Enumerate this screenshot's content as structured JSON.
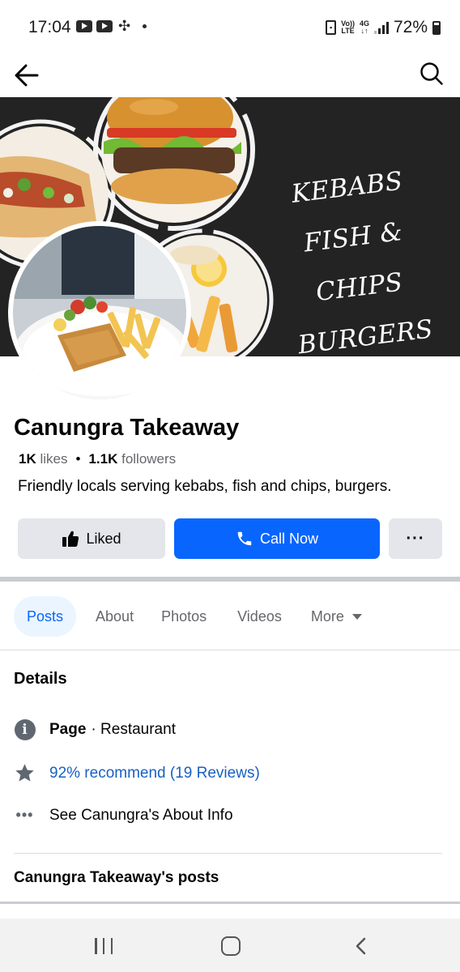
{
  "status_bar": {
    "time": "17:04",
    "battery": "72%",
    "volte_line1": "Vo))",
    "volte_line2": "LTE",
    "network_line1": "4G",
    "network_line2": "↓↑",
    "icons": [
      "youtube-icon",
      "youtube-icon",
      "fan-icon",
      "dot-icon",
      "sim-icon",
      "volte-icon",
      "4g-icon",
      "signal-icon",
      "battery-icon"
    ]
  },
  "header": {
    "icons": [
      "back-arrow-icon",
      "search-icon"
    ]
  },
  "cover": {
    "lines": [
      "KEBABS",
      "FISH & CHIPS",
      "BURGERS"
    ]
  },
  "page": {
    "name": "Canungra Takeaway",
    "likes_count": "1K",
    "likes_label": "likes",
    "separator": "•",
    "followers_count": "1.1K",
    "followers_label": "followers",
    "description": "Friendly locals serving kebabs, fish and chips, burgers."
  },
  "actions": {
    "liked_label": "Liked",
    "call_label": "Call Now",
    "more_label": "···"
  },
  "tabs": [
    {
      "label": "Posts",
      "active": true
    },
    {
      "label": "About"
    },
    {
      "label": "Photos"
    },
    {
      "label": "Videos"
    },
    {
      "label": "More"
    }
  ],
  "details": {
    "title": "Details",
    "page_label": "Page",
    "page_category": "· Restaurant",
    "reviews": "92% recommend (19 Reviews)",
    "about_link": "See Canungra's About Info",
    "more_dots": "•••"
  },
  "posts_section": {
    "title": "Canungra Takeaway's posts"
  },
  "colors": {
    "accent": "#0866ff",
    "link": "#1861c4",
    "button_gray": "#e4e6eb",
    "active_tab_bg": "#ebf5ff",
    "cover_bg": "#232323"
  }
}
